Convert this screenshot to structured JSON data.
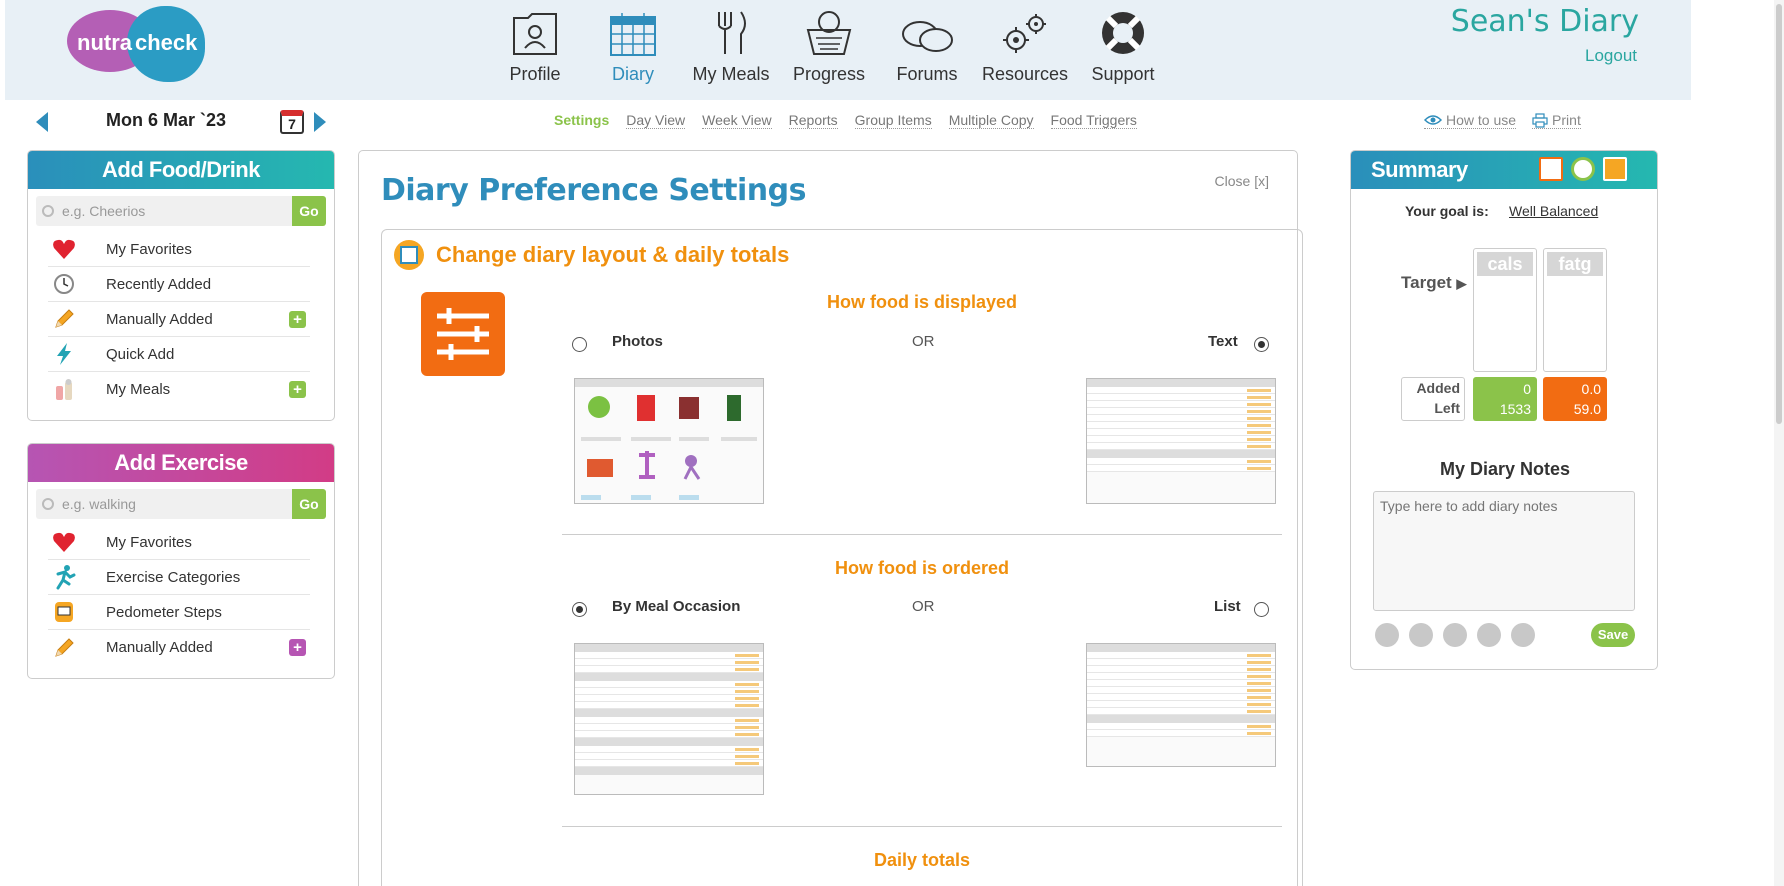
{
  "header": {
    "logo_left": "nutra",
    "logo_right": "check",
    "nav": [
      {
        "label": "Profile",
        "icon": "profile-icon"
      },
      {
        "label": "Diary",
        "icon": "calendar-icon",
        "active": true
      },
      {
        "label": "My Meals",
        "icon": "fork-knife-icon"
      },
      {
        "label": "Progress",
        "icon": "scale-icon"
      },
      {
        "label": "Forums",
        "icon": "chat-bubbles-icon"
      },
      {
        "label": "Resources",
        "icon": "gears-icon"
      },
      {
        "label": "Support",
        "icon": "lifebuoy-icon"
      }
    ],
    "diary_title": "Sean's Diary",
    "logout": "Logout"
  },
  "datebar": {
    "date": "Mon 6 Mar `23",
    "calendar_day": "7"
  },
  "subnav": {
    "items": [
      "Settings",
      "Day View",
      "Week View",
      "Reports",
      "Group Items",
      "Multiple Copy",
      "Food Triggers"
    ],
    "active": "Settings"
  },
  "tools": {
    "how_to_use": "How to use",
    "print": "Print"
  },
  "food_panel": {
    "title": "Add Food/Drink",
    "search_placeholder": "e.g. Cheerios",
    "go": "Go",
    "items": [
      {
        "label": "My Favorites",
        "icon": "heart-icon"
      },
      {
        "label": "Recently Added",
        "icon": "clock-icon"
      },
      {
        "label": "Manually Added",
        "icon": "pencil-icon",
        "plus": true
      },
      {
        "label": "Quick Add",
        "icon": "lightning-icon"
      },
      {
        "label": "My Meals",
        "icon": "salt-pepper-icon",
        "plus": true
      }
    ]
  },
  "exercise_panel": {
    "title": "Add Exercise",
    "search_placeholder": "e.g. walking",
    "go": "Go",
    "items": [
      {
        "label": "My Favorites",
        "icon": "heart-icon"
      },
      {
        "label": "Exercise Categories",
        "icon": "runner-icon"
      },
      {
        "label": "Pedometer Steps",
        "icon": "pedometer-icon"
      },
      {
        "label": "Manually Added",
        "icon": "pencil-icon",
        "plus": true
      }
    ]
  },
  "settings": {
    "title": "Diary Preference Settings",
    "close": "Close [x]",
    "section_title": "Change diary layout & daily totals",
    "displayed": {
      "title": "How food is displayed",
      "left": "Photos",
      "right": "Text",
      "or": "OR",
      "selected": "right"
    },
    "ordered": {
      "title": "How food is ordered",
      "left": "By Meal Occasion",
      "right": "List",
      "or": "OR",
      "selected": "left"
    },
    "daily_totals": "Daily totals"
  },
  "summary": {
    "title": "Summary",
    "goal_label": "Your goal is:",
    "goal_value": "Well Balanced",
    "target_label": "Target",
    "col1": "cals",
    "col2": "fatg",
    "added_label": "Added",
    "left_label": "Left",
    "cals_added": "0",
    "cals_left": "1533",
    "fat_added": "0.0",
    "fat_left": "59.0",
    "notes_title": "My Diary Notes",
    "notes_placeholder": "Type here to add diary notes",
    "save": "Save"
  }
}
